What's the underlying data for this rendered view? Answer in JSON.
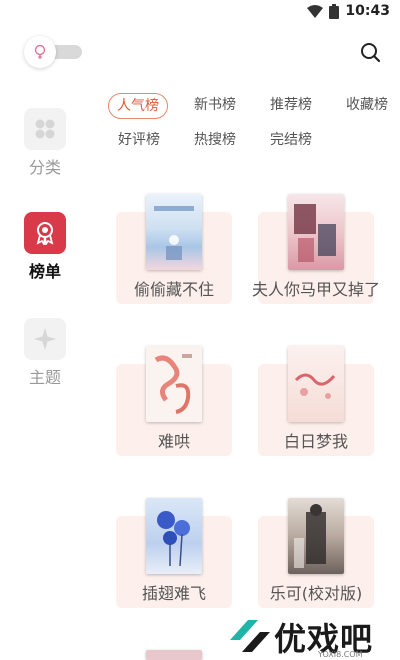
{
  "status_bar": {
    "time": "10:43",
    "wifi_icon": "wifi-icon",
    "battery_icon": "battery-icon"
  },
  "header": {
    "theme_toggle_icon": "lightbulb-icon",
    "search_icon": "search-icon"
  },
  "sidebar": {
    "items": [
      {
        "label": "分类",
        "icon": "grid-icon",
        "active": false
      },
      {
        "label": "榜单",
        "icon": "ribbon-badge-icon",
        "active": true
      },
      {
        "label": "主题",
        "icon": "compass-star-icon",
        "active": false
      }
    ]
  },
  "tabs": [
    {
      "label": "人气榜",
      "active": true
    },
    {
      "label": "新书榜",
      "active": false
    },
    {
      "label": "推荐榜",
      "active": false
    },
    {
      "label": "收藏榜",
      "active": false
    },
    {
      "label": "好评榜",
      "active": false
    },
    {
      "label": "热搜榜",
      "active": false
    },
    {
      "label": "完结榜",
      "active": false
    }
  ],
  "books": [
    {
      "title": "偷偷藏不住"
    },
    {
      "title": "夫人你马甲又掉了"
    },
    {
      "title": "难哄"
    },
    {
      "title": "白日梦我"
    },
    {
      "title": "插翅难飞"
    },
    {
      "title": "乐可(校对版)"
    }
  ],
  "watermark": {
    "text": "优戏吧",
    "sub": "YOXI8.COM"
  },
  "colors": {
    "accent": "#e05a34",
    "active_icon_bg": "#d93a4a",
    "card_bg": "#fdf0ec"
  }
}
